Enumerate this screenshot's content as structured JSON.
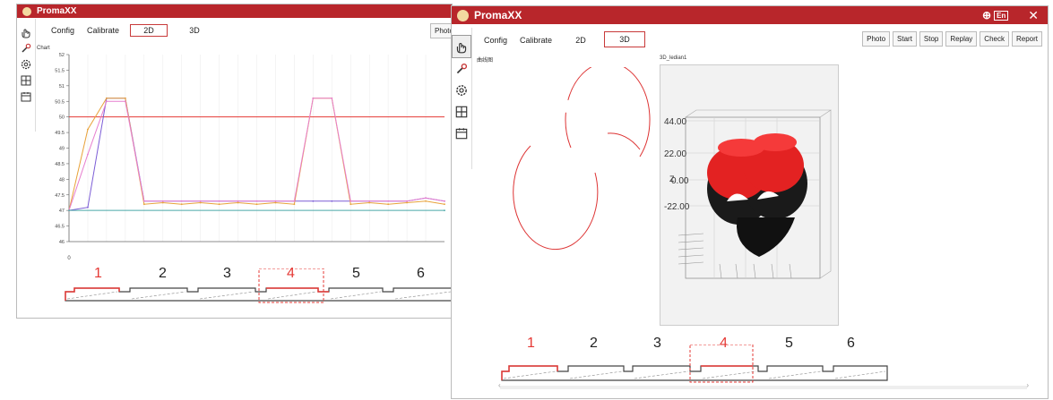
{
  "app": {
    "title": "PromaXX"
  },
  "tabs": [
    {
      "label": "Config",
      "active": false
    },
    {
      "label": "Calibrate",
      "active": false
    },
    {
      "label": "2D",
      "active": true
    },
    {
      "label": "3D",
      "active": true
    }
  ],
  "left_window": {
    "toolbar_partial": "Photo",
    "chart_title": "Chart",
    "y_ticks": [
      "52",
      "51.5",
      "51",
      "50.5",
      "50",
      "49.5",
      "49",
      "48.5",
      "48",
      "47.5",
      "47",
      "46.5",
      "46"
    ],
    "x_tick": "0",
    "section_numbers": [
      "1",
      "2",
      "3",
      "4",
      "5",
      "6"
    ]
  },
  "right_window": {
    "lang": "En",
    "toolbar": [
      "Photo",
      "Start",
      "Stop",
      "Replay",
      "Check",
      "Report"
    ],
    "left_panel_label": "曲线图",
    "right_panel_label": "3D_ledian1",
    "z_ticks": [
      "44.00",
      "22.00",
      "0.00",
      "-22.00"
    ],
    "z_axis_label": "Z",
    "section_numbers": [
      "1",
      "2",
      "3",
      "4",
      "5",
      "6"
    ]
  },
  "colors": {
    "brand": "#b8262b",
    "accent_red": "#e53935"
  },
  "chart_data": {
    "type": "line",
    "ylim": [
      46,
      52
    ],
    "ytick_labels": [
      "52",
      "51.5",
      "51",
      "50.5",
      "50",
      "49.5",
      "49",
      "48.5",
      "48",
      "47.5",
      "47",
      "46.5",
      "46"
    ],
    "xtick_labels": [
      "0"
    ],
    "title": "Chart",
    "reference_line": 50,
    "series": [
      {
        "color": "#7b5cd6",
        "x": [
          0,
          1,
          2,
          3,
          4,
          5,
          6,
          7,
          8,
          9,
          10,
          11,
          12,
          13,
          14,
          15,
          16,
          17,
          18,
          19,
          20
        ],
        "y": [
          47,
          47.1,
          50.6,
          50.6,
          47.3,
          47.3,
          47.3,
          47.3,
          47.3,
          47.3,
          47.3,
          47.3,
          47.3,
          47.3,
          47.3,
          47.3,
          47.3,
          47.3,
          47.3,
          47.4,
          47.3
        ]
      },
      {
        "color": "#e8a23a",
        "x": [
          0,
          1,
          2,
          3,
          4,
          5,
          6,
          7,
          8,
          9,
          10,
          11,
          12,
          13,
          14,
          15,
          16,
          17,
          18,
          19,
          20
        ],
        "y": [
          47,
          49.6,
          50.6,
          50.6,
          47.2,
          47.25,
          47.2,
          47.25,
          47.2,
          47.25,
          47.2,
          47.25,
          47.2,
          50.6,
          50.6,
          47.2,
          47.25,
          47.2,
          47.25,
          47.3,
          47.2
        ]
      },
      {
        "color": "#e77fcf",
        "x": [
          0,
          1,
          2,
          3,
          4,
          5,
          6,
          7,
          8,
          9,
          10,
          11,
          12,
          13,
          14,
          15,
          16,
          17,
          18,
          19,
          20
        ],
        "y": [
          47,
          48.8,
          50.5,
          50.5,
          47.3,
          47.3,
          47.3,
          47.3,
          47.3,
          47.3,
          47.3,
          47.3,
          47.3,
          50.6,
          50.6,
          47.3,
          47.3,
          47.3,
          47.3,
          47.4,
          47.3
        ]
      },
      {
        "color": "#4aa6a6",
        "x": [
          0,
          20
        ],
        "y": [
          47,
          47
        ]
      }
    ]
  }
}
